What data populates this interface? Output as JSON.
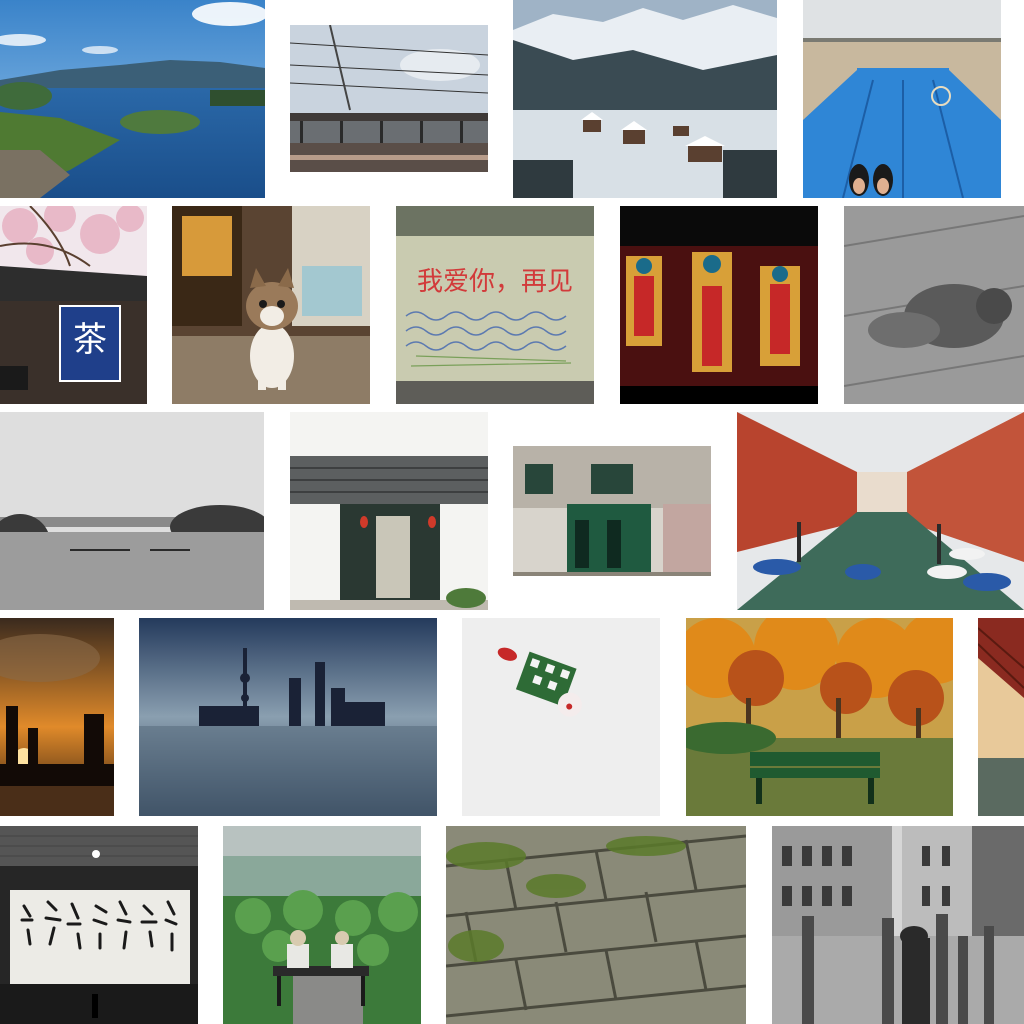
{
  "collage": {
    "photos": [
      {
        "name": "lake-islands-photo"
      },
      {
        "name": "railway-platform-photo"
      },
      {
        "name": "snowy-village-photo"
      },
      {
        "name": "blue-boat-bow-photo"
      },
      {
        "name": "tea-house-blossom-photo",
        "banner_text": "茶"
      },
      {
        "name": "cat-street-photo"
      },
      {
        "name": "graffiti-wall-photo",
        "wall_text": "我爱你，再见"
      },
      {
        "name": "shadow-puppets-photo"
      },
      {
        "name": "sleeping-squirrel-photo"
      },
      {
        "name": "misty-lake-bw-photo"
      },
      {
        "name": "chinese-doorway-photo"
      },
      {
        "name": "green-storefront-photo"
      },
      {
        "name": "venice-canal-photo"
      },
      {
        "name": "city-sunset-silhouette-photo"
      },
      {
        "name": "shanghai-skyline-photo"
      },
      {
        "name": "clown-doll-photo"
      },
      {
        "name": "autumn-park-bench-photo"
      },
      {
        "name": "bridge-sea-photo"
      },
      {
        "name": "calligraphy-wall-photo"
      },
      {
        "name": "lotus-pond-couple-photo"
      },
      {
        "name": "mossy-brick-wall-photo"
      },
      {
        "name": "venice-couple-bw-photo"
      }
    ]
  }
}
